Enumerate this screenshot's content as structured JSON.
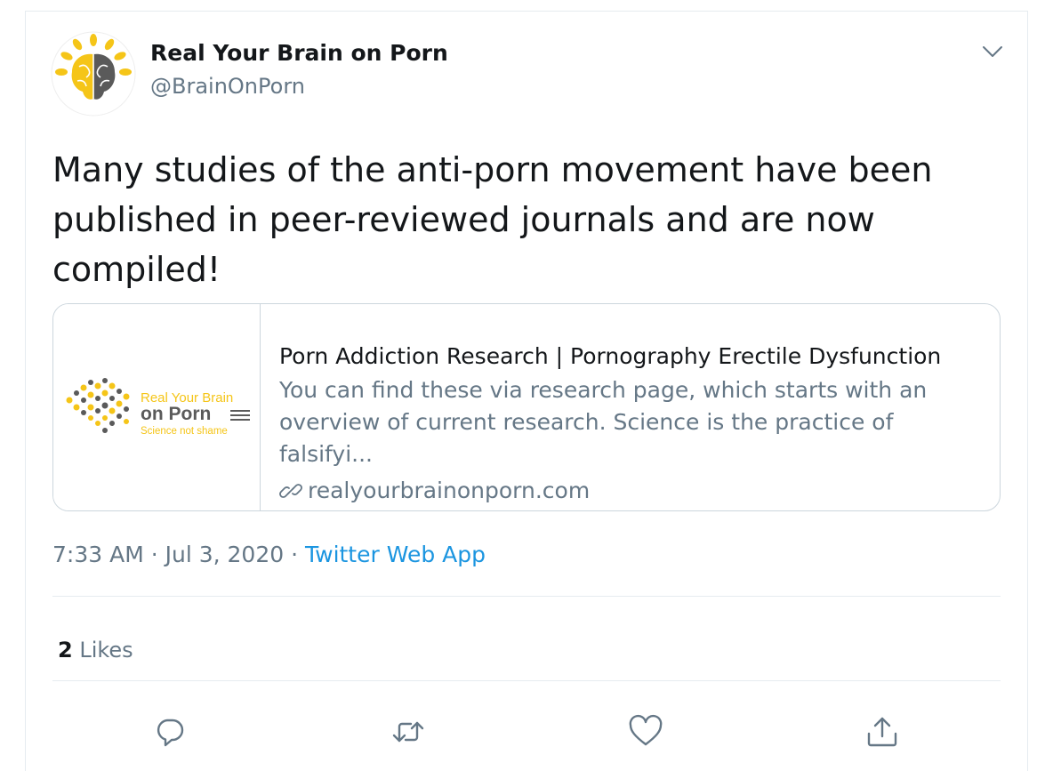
{
  "author": {
    "display_name": "Real Your Brain on Porn",
    "handle": "@BrainOnPorn",
    "avatar_icon": "brain-sun-logo-icon"
  },
  "tweet": {
    "text": "Many studies of the anti-porn movement have been published in peer-reviewed journals and are now compiled!"
  },
  "link_card": {
    "logo_text_line1": "Real Your Brain",
    "logo_text_line2": "on Porn",
    "logo_tagline": "Science not shame",
    "title": "Porn Addiction Research | Pornography Erectile Dysfunction",
    "description_line1": "You can find these via research page, which starts with an",
    "description_line2": "overview of current research. Science is the practice of falsifyi...",
    "domain": "realyourbrainonporn.com",
    "domain_icon": "link-icon"
  },
  "meta": {
    "time_date": "7:33 AM · Jul 3, 2020 · ",
    "source": "Twitter Web App"
  },
  "stats": {
    "likes_count": "2",
    "likes_label": " Likes"
  },
  "actions": {
    "reply_icon": "reply-icon",
    "retweet_icon": "retweet-icon",
    "like_icon": "heart-icon",
    "share_icon": "share-icon"
  },
  "colors": {
    "accent": "#1b95e0",
    "secondary_text": "#657786",
    "primary_text": "#14171a",
    "border": "#ccd6dd",
    "logo_yellow": "#f5c518",
    "logo_gray": "#5a5a5a"
  }
}
